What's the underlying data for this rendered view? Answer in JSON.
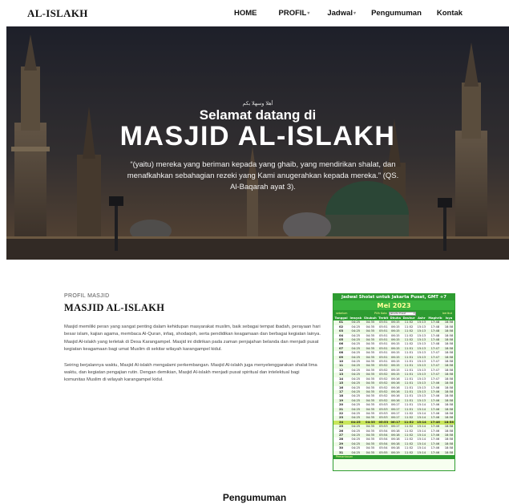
{
  "nav": {
    "brand": "AL-ISLAKH",
    "items": [
      {
        "label": "HOME",
        "dropdown": false
      },
      {
        "label": "PROFIL",
        "dropdown": true
      },
      {
        "label": "Jadwal",
        "dropdown": true
      },
      {
        "label": "Pengumuman",
        "dropdown": false
      },
      {
        "label": "Kontak",
        "dropdown": false
      }
    ]
  },
  "hero": {
    "arabic": "أهلا وسهلا بكم",
    "greeting": "Selamat datang di",
    "title": "MASJID AL-ISLAKH",
    "quote": "“(yaitu) mereka yang beriman kepada yang ghaib, yang mendirikan shalat, dan menafkahkan sebahagian rezeki yang Kami anugerahkan kepada mereka.” (QS. Al-Baqarah ayat 3)."
  },
  "profile": {
    "label": "PROFIL MASJID",
    "title": "MASJID AL-ISLAKH",
    "para1": "Masjid memiliki peran yang sangat penting dalam kehidupan masyarakat muslim, baik sebagai tempat ibadah, perayaan hari besar islam, kajian agama, membaca Al-Quran, infaq, shodaqoh, serta pendidikan keagamaan dan berbagai kegiatan lainya. Masjid Al-islakh yang terletak di Desa Karangampel. Masjid ini didirikan pada zaman penjajahan belanda dan menjadi pusat kegiatan keagamaan bagi umat Muslim di sekitar wilayah karangampel kidul.",
    "para2": "Seiring berjalannya waktu, Masjid Al-islakh mengalami perkembangan. Masjid Al-islakh juga menyelenggarakan shalat lima waktu, dan kegiatan pengajian rutin. Dengan demikian, Masjid Al-islakh menjadi pusat spiritual dan intelektual bagi komunitas Muslim di wilayah karangampel kidul."
  },
  "schedule": {
    "header": "Jadwal Sholat untuk Jakarta Pusat, GMT +7",
    "month": "Mei 2023",
    "prev": "sebelum",
    "pick_label": "Pilih Kota",
    "city": "Jakarta Pusat",
    "next": "berikut",
    "columns": [
      "Tanggal",
      "Imsyak",
      "Shubuh",
      "Terbit",
      "Dhuha",
      "Dzuhur",
      "Ashr",
      "Maghrib",
      "Isya"
    ],
    "rows": [
      [
        "01",
        "04:25",
        "04:35",
        "05:51",
        "06:15",
        "11:52",
        "15:13",
        "17:48",
        "18:58"
      ],
      [
        "02",
        "04:25",
        "04:35",
        "05:51",
        "06:15",
        "11:52",
        "15:13",
        "17:48",
        "18:58"
      ],
      [
        "03",
        "04:25",
        "04:35",
        "05:51",
        "06:15",
        "11:52",
        "15:13",
        "17:48",
        "18:58"
      ],
      [
        "04",
        "04:25",
        "04:35",
        "05:51",
        "06:15",
        "11:52",
        "15:13",
        "17:48",
        "18:58"
      ],
      [
        "05",
        "04:25",
        "04:35",
        "05:51",
        "06:15",
        "11:52",
        "15:13",
        "17:48",
        "18:58"
      ],
      [
        "06",
        "04:25",
        "04:35",
        "05:51",
        "06:15",
        "11:52",
        "15:13",
        "17:48",
        "18:58"
      ],
      [
        "07",
        "04:25",
        "04:35",
        "05:51",
        "06:15",
        "11:51",
        "15:13",
        "17:47",
        "18:58"
      ],
      [
        "08",
        "04:25",
        "04:35",
        "05:51",
        "06:15",
        "11:51",
        "15:13",
        "17:47",
        "18:58"
      ],
      [
        "09",
        "04:25",
        "04:35",
        "05:51",
        "06:15",
        "11:51",
        "15:13",
        "17:47",
        "18:58"
      ],
      [
        "10",
        "04:25",
        "04:35",
        "05:51",
        "06:15",
        "11:51",
        "15:13",
        "17:47",
        "18:58"
      ],
      [
        "11",
        "04:25",
        "04:35",
        "05:52",
        "06:15",
        "11:51",
        "15:13",
        "17:47",
        "18:58"
      ],
      [
        "12",
        "04:25",
        "04:35",
        "05:52",
        "06:15",
        "11:51",
        "15:13",
        "17:47",
        "18:58"
      ],
      [
        "13",
        "04:25",
        "04:35",
        "05:52",
        "06:15",
        "11:51",
        "15:13",
        "17:47",
        "18:58"
      ],
      [
        "14",
        "04:25",
        "04:35",
        "05:52",
        "06:16",
        "11:51",
        "15:13",
        "17:47",
        "18:58"
      ],
      [
        "15",
        "04:25",
        "04:35",
        "05:52",
        "06:16",
        "11:51",
        "15:13",
        "17:46",
        "18:58"
      ],
      [
        "16",
        "04:25",
        "04:35",
        "05:52",
        "06:16",
        "11:51",
        "15:13",
        "17:46",
        "18:58"
      ],
      [
        "17",
        "04:25",
        "04:35",
        "05:52",
        "06:16",
        "11:51",
        "15:13",
        "17:46",
        "18:58"
      ],
      [
        "18",
        "04:25",
        "04:35",
        "05:52",
        "06:16",
        "11:51",
        "15:13",
        "17:46",
        "18:58"
      ],
      [
        "19",
        "04:25",
        "04:35",
        "05:52",
        "06:16",
        "11:51",
        "15:13",
        "17:46",
        "18:58"
      ],
      [
        "20",
        "04:25",
        "04:35",
        "05:53",
        "06:17",
        "11:51",
        "15:14",
        "17:46",
        "18:58"
      ],
      [
        "21",
        "04:25",
        "04:35",
        "05:53",
        "06:17",
        "11:51",
        "15:14",
        "17:46",
        "18:58"
      ],
      [
        "22",
        "04:25",
        "04:35",
        "05:53",
        "06:17",
        "11:52",
        "15:14",
        "17:46",
        "18:58"
      ],
      [
        "23",
        "04:25",
        "04:35",
        "05:53",
        "06:17",
        "11:52",
        "15:14",
        "17:46",
        "18:58"
      ],
      [
        "24",
        "04:25",
        "04:35",
        "05:53",
        "06:17",
        "11:52",
        "15:14",
        "17:46",
        "18:58"
      ],
      [
        "25",
        "04:25",
        "04:35",
        "05:53",
        "06:17",
        "11:52",
        "15:14",
        "17:46",
        "18:58"
      ],
      [
        "26",
        "04:25",
        "04:35",
        "05:54",
        "06:18",
        "11:52",
        "15:14",
        "17:46",
        "18:58"
      ],
      [
        "27",
        "04:25",
        "04:35",
        "05:54",
        "06:18",
        "11:52",
        "15:14",
        "17:46",
        "18:58"
      ],
      [
        "28",
        "04:25",
        "04:35",
        "05:54",
        "06:18",
        "11:52",
        "15:14",
        "17:46",
        "18:58"
      ],
      [
        "29",
        "04:25",
        "04:35",
        "05:54",
        "06:18",
        "11:52",
        "15:14",
        "17:46",
        "18:58"
      ],
      [
        "30",
        "04:25",
        "04:35",
        "05:54",
        "06:18",
        "11:52",
        "15:14",
        "17:46",
        "18:58"
      ],
      [
        "31",
        "04:25",
        "04:35",
        "05:55",
        "06:19",
        "11:52",
        "15:14",
        "17:46",
        "18:58"
      ]
    ],
    "highlight_row": "24",
    "footer": "Pemantauan",
    "colors": {
      "primary": "#2d9b31",
      "highlight": "#c8e65a",
      "title_text": "#ffff99"
    }
  },
  "announcement": {
    "title": "Pengumuman"
  }
}
